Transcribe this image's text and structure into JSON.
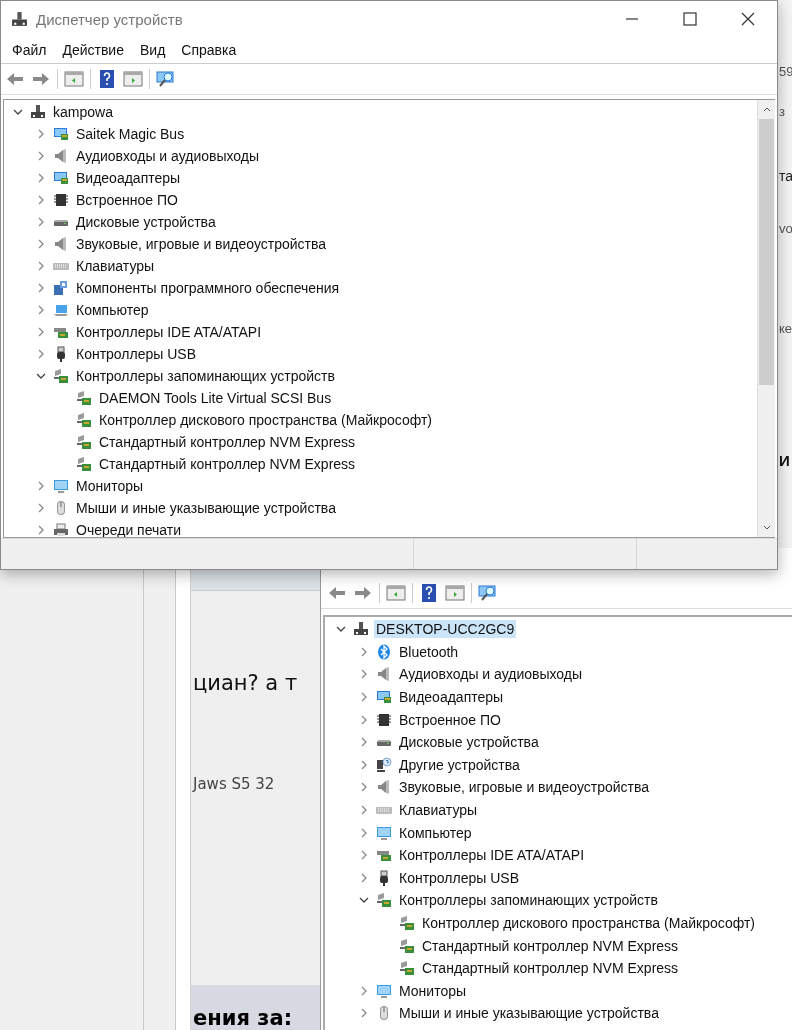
{
  "top_window": {
    "title": "Диспетчер устройств",
    "menu": [
      "Файл",
      "Действие",
      "Вид",
      "Справка"
    ],
    "tree": {
      "label": "kampowa",
      "kind": "root",
      "expanded": true,
      "children": [
        {
          "label": "Saitek Magic Bus",
          "kind": "display",
          "expanded": false
        },
        {
          "label": "Аудиовходы и аудиовыходы",
          "kind": "audio",
          "expanded": false
        },
        {
          "label": "Видеоадаптеры",
          "kind": "display",
          "expanded": false
        },
        {
          "label": "Встроенное ПО",
          "kind": "firmware",
          "expanded": false
        },
        {
          "label": "Дисковые устройства",
          "kind": "disk",
          "expanded": false
        },
        {
          "label": "Звуковые, игровые и видеоустройства",
          "kind": "audio",
          "expanded": false
        },
        {
          "label": "Клавиатуры",
          "kind": "keyboard",
          "expanded": false
        },
        {
          "label": "Компоненты программного обеспечения",
          "kind": "software",
          "expanded": false
        },
        {
          "label": "Компьютер",
          "kind": "laptop",
          "expanded": false
        },
        {
          "label": "Контроллеры IDE ATA/ATAPI",
          "kind": "ide",
          "expanded": false
        },
        {
          "label": "Контроллеры USB",
          "kind": "usb",
          "expanded": false
        },
        {
          "label": "Контроллеры запоминающих устройств",
          "kind": "storage",
          "expanded": true,
          "children": [
            {
              "label": "DAEMON Tools Lite Virtual SCSI Bus",
              "kind": "storage"
            },
            {
              "label": "Контроллер дискового пространства (Майкрософт)",
              "kind": "storage"
            },
            {
              "label": "Стандартный контроллер NVM Express",
              "kind": "storage"
            },
            {
              "label": "Стандартный контроллер NVM Express",
              "kind": "storage"
            }
          ]
        },
        {
          "label": "Мониторы",
          "kind": "monitor",
          "expanded": false
        },
        {
          "label": "Мыши и иные указывающие устройства",
          "kind": "mouse",
          "expanded": false
        },
        {
          "label": "Очереди печати",
          "kind": "printer",
          "expanded": false
        }
      ]
    }
  },
  "right_edge_fragments": [
    {
      "text": "59",
      "kind": "plain"
    },
    {
      "text": "з",
      "kind": "plain"
    },
    {
      "text": "та",
      "kind": "plain"
    },
    {
      "text": "vo",
      "kind": "plain"
    },
    {
      "text": "ке",
      "kind": "plain"
    },
    {
      "text": "И",
      "kind": "bold"
    }
  ],
  "forum_page": {
    "texts": [
      {
        "text": "циан? а т",
        "kind": "heading"
      },
      {
        "text": "Jaws S5 32",
        "kind": "note"
      },
      {
        "text": "ения за:",
        "kind": "band"
      }
    ]
  },
  "bottom_window": {
    "tree": {
      "label": "DESKTOP-UCC2GC9",
      "kind": "root",
      "expanded": true,
      "selected": true,
      "children": [
        {
          "label": "Bluetooth",
          "kind": "bluetooth",
          "expanded": false
        },
        {
          "label": "Аудиовходы и аудиовыходы",
          "kind": "audio",
          "expanded": false
        },
        {
          "label": "Видеоадаптеры",
          "kind": "display",
          "expanded": false
        },
        {
          "label": "Встроенное ПО",
          "kind": "firmware",
          "expanded": false
        },
        {
          "label": "Дисковые устройства",
          "kind": "disk",
          "expanded": false
        },
        {
          "label": "Другие устройства",
          "kind": "unknown",
          "expanded": false
        },
        {
          "label": "Звуковые, игровые и видеоустройства",
          "kind": "audio",
          "expanded": false
        },
        {
          "label": "Клавиатуры",
          "kind": "keyboard",
          "expanded": false
        },
        {
          "label": "Компьютер",
          "kind": "monitor",
          "expanded": false
        },
        {
          "label": "Контроллеры IDE ATA/ATAPI",
          "kind": "ide",
          "expanded": false
        },
        {
          "label": "Контроллеры USB",
          "kind": "usb",
          "expanded": false
        },
        {
          "label": "Контроллеры запоминающих устройств",
          "kind": "storage",
          "expanded": true,
          "children": [
            {
              "label": "Контроллер дискового пространства (Майкрософт)",
              "kind": "storage"
            },
            {
              "label": "Стандартный контроллер NVM Express",
              "kind": "storage"
            },
            {
              "label": "Стандартный контроллер NVM Express",
              "kind": "storage"
            }
          ]
        },
        {
          "label": "Мониторы",
          "kind": "monitor",
          "expanded": false
        },
        {
          "label": "Мыши и иные указывающие устройства",
          "kind": "mouse",
          "expanded": false
        }
      ]
    }
  }
}
